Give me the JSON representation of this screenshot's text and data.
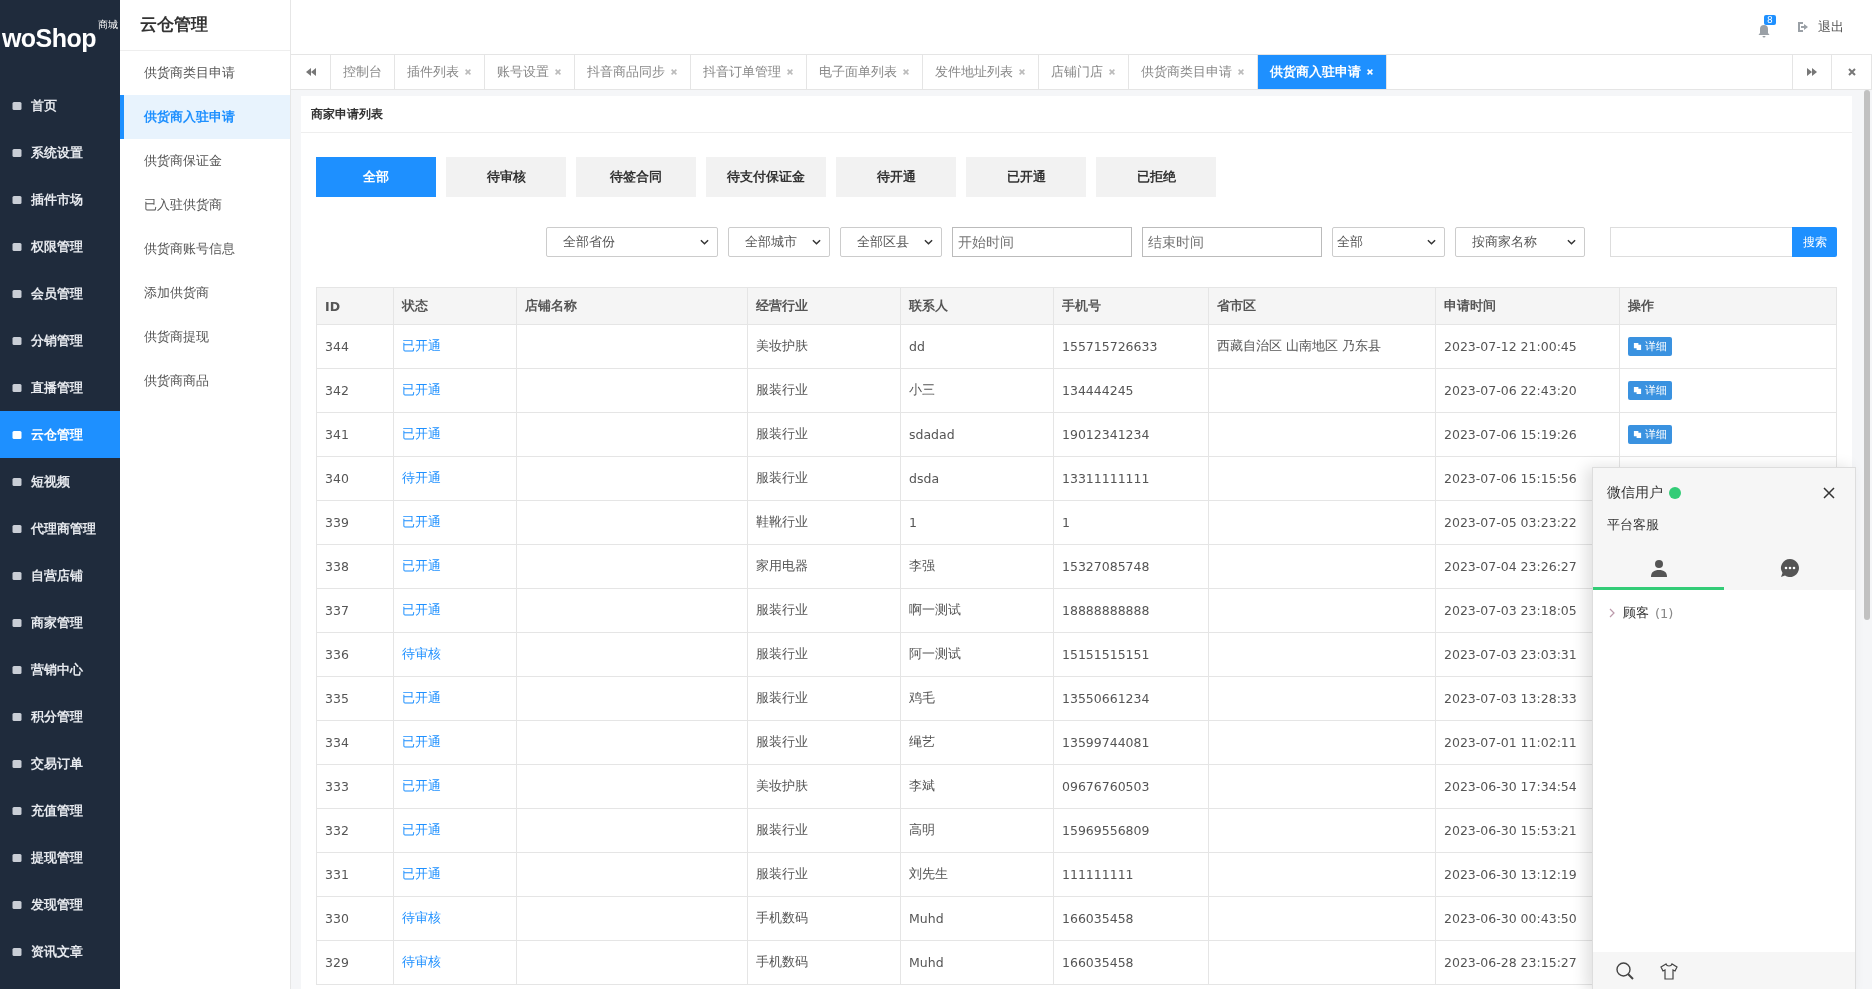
{
  "logo": {
    "text": "woShop",
    "badge": "商城"
  },
  "nav": [
    {
      "label": "首页",
      "selected": false
    },
    {
      "label": "系统设置",
      "selected": false
    },
    {
      "label": "插件市场",
      "selected": false
    },
    {
      "label": "权限管理",
      "selected": false
    },
    {
      "label": "会员管理",
      "selected": false
    },
    {
      "label": "分销管理",
      "selected": false
    },
    {
      "label": "直播管理",
      "selected": false
    },
    {
      "label": "云仓管理",
      "selected": true
    },
    {
      "label": "短视频",
      "selected": false
    },
    {
      "label": "代理商管理",
      "selected": false
    },
    {
      "label": "自营店铺",
      "selected": false
    },
    {
      "label": "商家管理",
      "selected": false
    },
    {
      "label": "营销中心",
      "selected": false
    },
    {
      "label": "积分管理",
      "selected": false
    },
    {
      "label": "交易订单",
      "selected": false
    },
    {
      "label": "充值管理",
      "selected": false
    },
    {
      "label": "提现管理",
      "selected": false
    },
    {
      "label": "发现管理",
      "selected": false
    },
    {
      "label": "资讯文章",
      "selected": false
    }
  ],
  "subnav": {
    "title": "云仓管理",
    "items": [
      {
        "label": "供货商类目申请",
        "selected": false
      },
      {
        "label": "供货商入驻申请",
        "selected": true
      },
      {
        "label": "供货商保证金",
        "selected": false
      },
      {
        "label": "已入驻供货商",
        "selected": false
      },
      {
        "label": "供货商账号信息",
        "selected": false
      },
      {
        "label": "添加供货商",
        "selected": false
      },
      {
        "label": "供货商提现",
        "selected": false
      },
      {
        "label": "供货商商品",
        "selected": false
      }
    ]
  },
  "header": {
    "notifications": "8",
    "logout": "退出"
  },
  "tabs": [
    {
      "label": "控制台",
      "closable": false,
      "selected": false
    },
    {
      "label": "插件列表",
      "closable": true,
      "selected": false
    },
    {
      "label": "账号设置",
      "closable": true,
      "selected": false
    },
    {
      "label": "抖音商品同步",
      "closable": true,
      "selected": false
    },
    {
      "label": "抖音订单管理",
      "closable": true,
      "selected": false
    },
    {
      "label": "电子面单列表",
      "closable": true,
      "selected": false
    },
    {
      "label": "发件地址列表",
      "closable": true,
      "selected": false
    },
    {
      "label": "店铺门店",
      "closable": true,
      "selected": false
    },
    {
      "label": "供货商类目申请",
      "closable": true,
      "selected": false
    },
    {
      "label": "供货商入驻申请",
      "closable": true,
      "selected": true
    }
  ],
  "panel_title": "商家申请列表",
  "status_filters": [
    {
      "label": "全部",
      "selected": true
    },
    {
      "label": "待审核",
      "selected": false
    },
    {
      "label": "待签合同",
      "selected": false
    },
    {
      "label": "待支付保证金",
      "selected": false
    },
    {
      "label": "待开通",
      "selected": false
    },
    {
      "label": "已开通",
      "selected": false
    },
    {
      "label": "已拒绝",
      "selected": false
    }
  ],
  "filters": [
    {
      "kind": "select",
      "value": "全部省份"
    },
    {
      "kind": "select",
      "value": "全部城市"
    },
    {
      "kind": "select",
      "value": "全部区县"
    },
    {
      "kind": "input",
      "placeholder": "开始时间"
    },
    {
      "kind": "input",
      "placeholder": "结束时间"
    },
    {
      "kind": "select",
      "value": "全部"
    },
    {
      "kind": "select",
      "value": "按商家名称"
    }
  ],
  "search_button": "搜索",
  "table": {
    "columns": [
      "ID",
      "状态",
      "店铺名称",
      "经营行业",
      "联系人",
      "手机号",
      "省市区",
      "申请时间",
      "操作"
    ],
    "rows": [
      {
        "id": "344",
        "status": "已开通",
        "industry": "美妆护肤",
        "contact": "dd",
        "phone": "155715726633",
        "region": "西藏自治区 山南地区 乃东县",
        "time": "2023-07-12 21:00:45",
        "action": "详细"
      },
      {
        "id": "342",
        "status": "已开通",
        "industry": "服装行业",
        "contact": "小三",
        "phone": "134444245",
        "time": "2023-07-06 22:43:20",
        "action": "详细"
      },
      {
        "id": "341",
        "status": "已开通",
        "industry": "服装行业",
        "contact": "sdadad",
        "phone": "19012341234",
        "time": "2023-07-06 15:19:26",
        "action": "详细"
      },
      {
        "id": "340",
        "status": "待开通",
        "industry": "服装行业",
        "contact": "dsda",
        "phone": "13311111111",
        "time": "2023-07-06 15:15:56"
      },
      {
        "id": "339",
        "status": "已开通",
        "industry": "鞋靴行业",
        "contact": "1",
        "phone": "1",
        "time": "2023-07-05 03:23:22"
      },
      {
        "id": "338",
        "status": "已开通",
        "industry": "家用电器",
        "contact": "李强",
        "phone": "15327085748",
        "time": "2023-07-04 23:26:27"
      },
      {
        "id": "337",
        "status": "已开通",
        "industry": "服装行业",
        "contact": "啊一测试",
        "phone": "18888888888",
        "time": "2023-07-03 23:18:05"
      },
      {
        "id": "336",
        "status": "待审核",
        "industry": "服装行业",
        "contact": "阿一测试",
        "phone": "15151515151",
        "time": "2023-07-03 23:03:31"
      },
      {
        "id": "335",
        "status": "已开通",
        "industry": "服装行业",
        "contact": "鸡毛",
        "phone": "13550661234",
        "time": "2023-07-03 13:28:33"
      },
      {
        "id": "334",
        "status": "已开通",
        "industry": "服装行业",
        "contact": "绳艺",
        "phone": "13599744081",
        "time": "2023-07-01 11:02:11"
      },
      {
        "id": "333",
        "status": "已开通",
        "industry": "美妆护肤",
        "contact": "李斌",
        "phone": "09676760503",
        "time": "2023-06-30 17:34:54"
      },
      {
        "id": "332",
        "status": "已开通",
        "industry": "服装行业",
        "contact": "高明",
        "phone": "15969556809",
        "time": "2023-06-30 15:53:21"
      },
      {
        "id": "331",
        "status": "已开通",
        "industry": "服装行业",
        "contact": "刘先生",
        "phone": "111111111",
        "time": "2023-06-30 13:12:19"
      },
      {
        "id": "330",
        "status": "待审核",
        "industry": "手机数码",
        "contact": "Muhd",
        "phone": "166035458",
        "time": "2023-06-30 00:43:50"
      },
      {
        "id": "329",
        "status": "待审核",
        "industry": "手机数码",
        "contact": "Muhd",
        "phone": "166035458",
        "time": "2023-06-28 23:15:27"
      }
    ]
  },
  "chat": {
    "name": "微信用户",
    "online": true,
    "subtitle": "平台客服",
    "tabs": [
      {
        "kind": "contacts",
        "selected": true
      },
      {
        "kind": "messages",
        "selected": false
      }
    ],
    "groups": [
      {
        "label": "顾客",
        "count": "(1)",
        "expanded": false
      }
    ]
  }
}
